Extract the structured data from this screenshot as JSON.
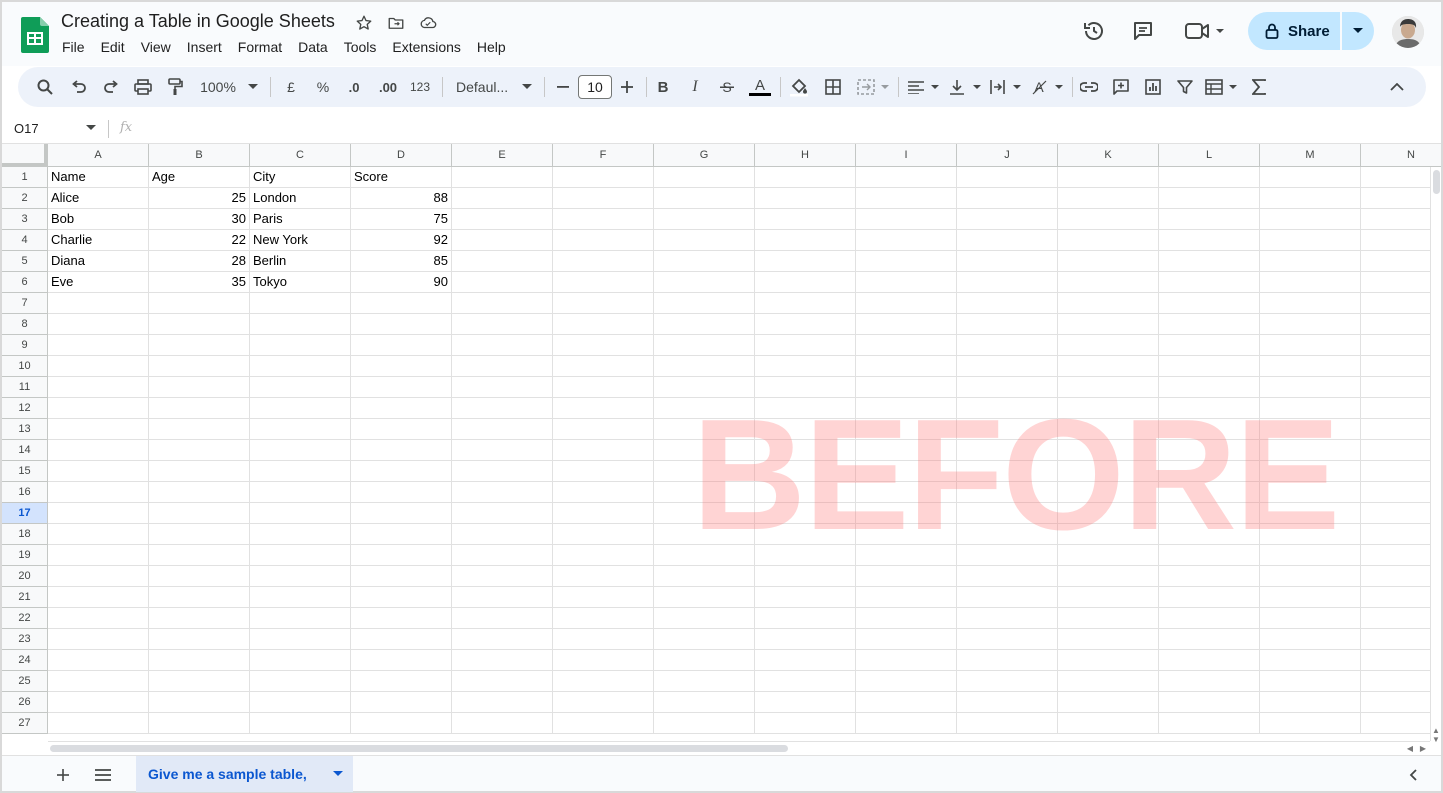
{
  "titlebar": {
    "doc_title": "Creating a Table in Google Sheets",
    "menus": [
      "File",
      "Edit",
      "View",
      "Insert",
      "Format",
      "Data",
      "Tools",
      "Extensions",
      "Help"
    ],
    "share_label": "Share"
  },
  "toolbar": {
    "zoom": "100%",
    "currency": "£",
    "percent": "%",
    "decrease_decimals": ".0",
    "increase_decimals": ".00",
    "number_format": "123",
    "font": "Defaul...",
    "font_size": "10"
  },
  "formula_bar": {
    "name_box": "O17",
    "fx_label": "fx",
    "content": ""
  },
  "grid": {
    "columns": [
      "A",
      "B",
      "C",
      "D",
      "E",
      "F",
      "G",
      "H",
      "I",
      "J",
      "K",
      "L",
      "M",
      "N"
    ],
    "row_numbers": [
      "1",
      "2",
      "3",
      "4",
      "5",
      "6",
      "7",
      "8",
      "9",
      "10",
      "11",
      "12",
      "13",
      "14",
      "15",
      "16",
      "17",
      "18",
      "19",
      "20",
      "21",
      "22",
      "23",
      "24",
      "25",
      "26",
      "27"
    ],
    "active_row": "17",
    "header": [
      "Name",
      "Age",
      "City",
      "Score"
    ],
    "rows": [
      [
        "Alice",
        "25",
        "London",
        "88"
      ],
      [
        "Bob",
        "30",
        "Paris",
        "75"
      ],
      [
        "Charlie",
        "22",
        "New York",
        "92"
      ],
      [
        "Diana",
        "28",
        "Berlin",
        "85"
      ],
      [
        "Eve",
        "35",
        "Tokyo",
        "90"
      ]
    ]
  },
  "watermark": "BEFORE",
  "sheet_tabs": [
    {
      "label": "Give me a sample table,",
      "active": true
    }
  ],
  "colors": {
    "accent": "#0b57d0",
    "share_bg": "#c2e7ff",
    "toolbar_bg": "#edf2fa",
    "watermark": "#ff7878",
    "sheets_green": "#0f9d58"
  }
}
